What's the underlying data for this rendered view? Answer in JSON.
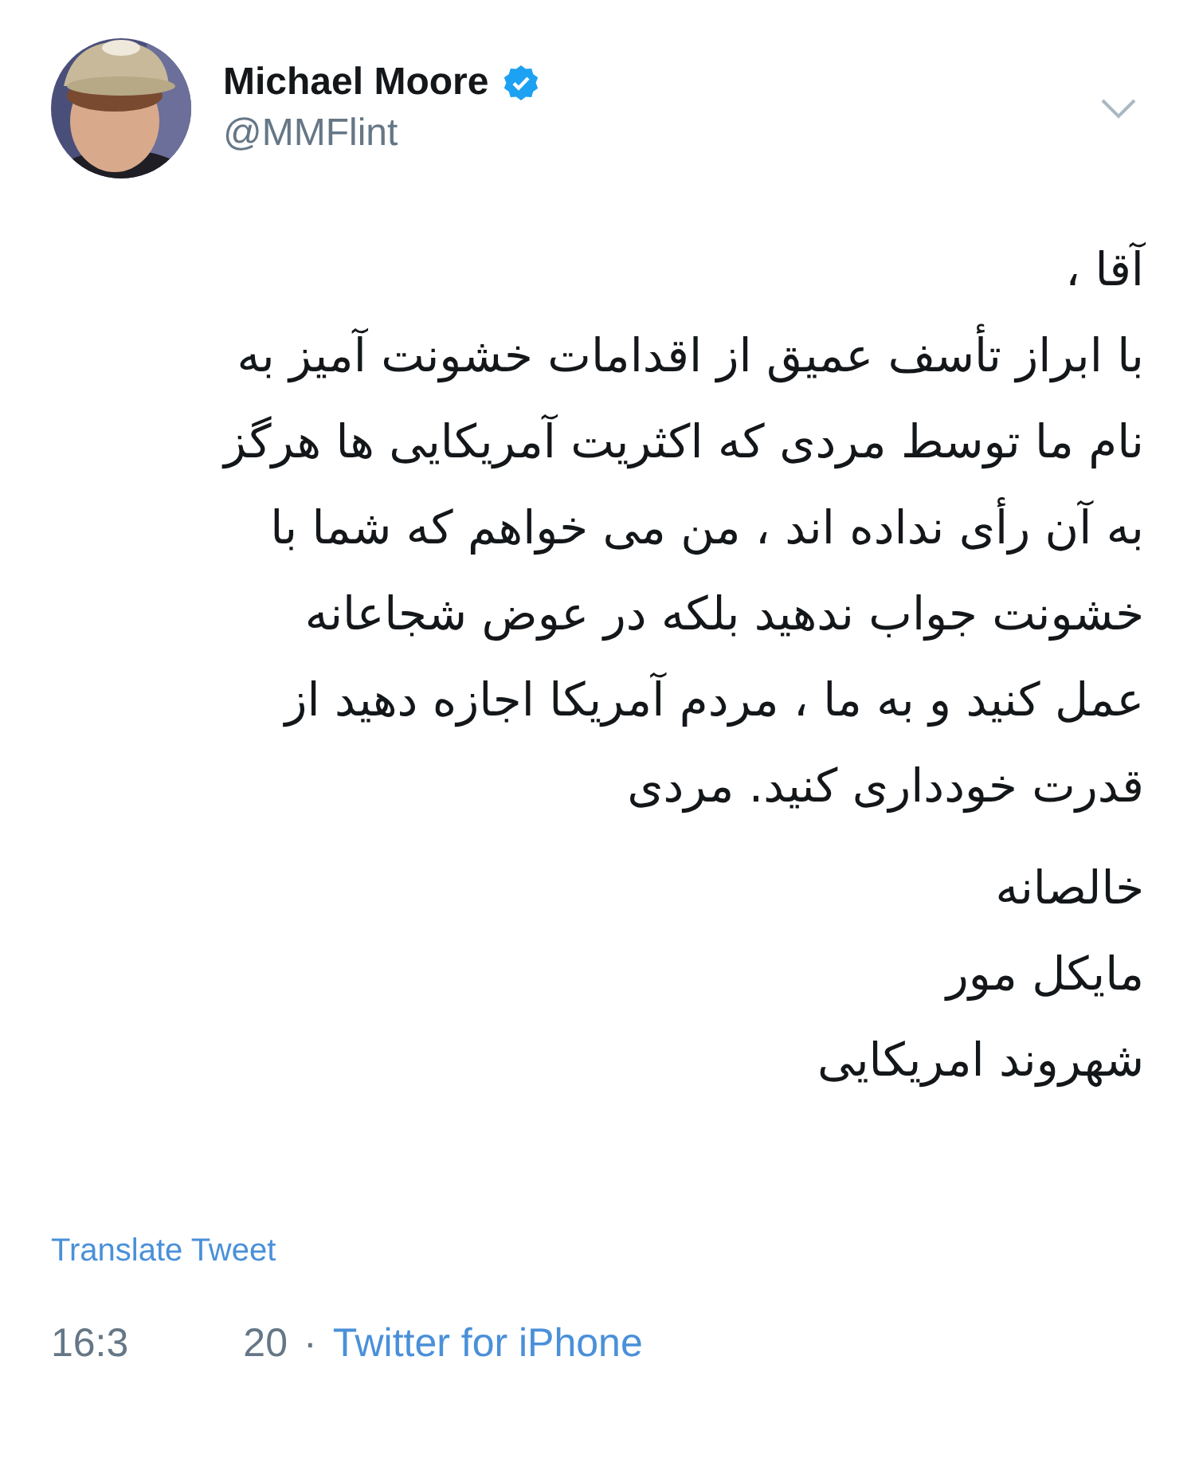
{
  "author": {
    "name": "Michael Moore",
    "verified": true,
    "handle": "@MMFlint"
  },
  "body": {
    "paragraphs": [
      [
        "آقا ،",
        "با ابراز تأسف عمیق از اقدامات خشونت آمیز به",
        "نام ما توسط مردی که اکثریت آمریکایی ها هرگز",
        "به آن رأی نداده اند ، من می خواهم که شما با",
        "خشونت جواب ندهید بلکه در عوض شجاعانه",
        "عمل کنید و به ما ، مردم آمریکا اجازه دهید از",
        "قدرت خودداری کنید. مردی"
      ],
      [
        "خالصانه",
        "مایکل مور",
        "شهروند امریکایی"
      ]
    ]
  },
  "translate_link": "Translate Tweet",
  "meta": {
    "time_start": "16:3",
    "time_end": "20",
    "separator": "·",
    "source": "Twitter for iPhone"
  }
}
